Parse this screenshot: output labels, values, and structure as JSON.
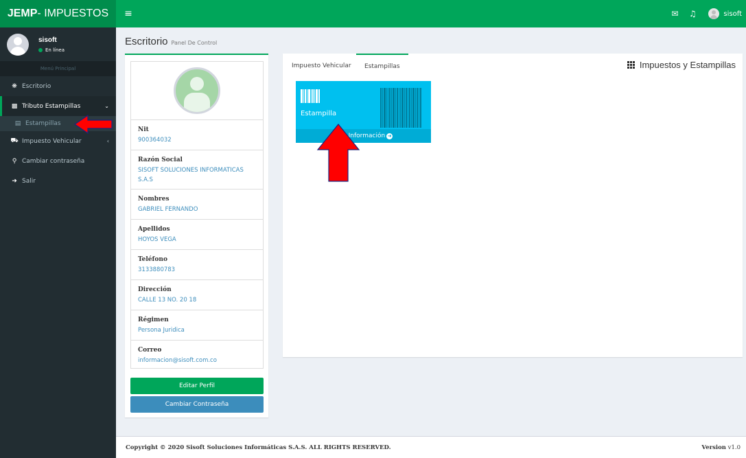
{
  "app": {
    "brand": "JEMP",
    "brand_rest": " - IMPUESTOS"
  },
  "topbar": {
    "user": "sisoft"
  },
  "sidebar": {
    "user_name": "sisoft",
    "status": "En línea",
    "menu_header": "Menú Principal",
    "items": [
      {
        "label": "Escritorio",
        "icon": "dashboard-icon"
      },
      {
        "label": "Tributo Estampillas",
        "icon": "barcode-icon"
      },
      {
        "label": "Estampillas",
        "icon": "file-icon"
      },
      {
        "label": "Impuesto Vehicular",
        "icon": "car-icon"
      },
      {
        "label": "Cambiar contraseña",
        "icon": "key-icon"
      },
      {
        "label": "Salir",
        "icon": "sign-out-icon"
      }
    ]
  },
  "header": {
    "title": "Escritorio",
    "subtitle": "Panel De Control"
  },
  "profile": {
    "fields": [
      {
        "label": "Nit",
        "value": "900364032"
      },
      {
        "label": "Razón Social",
        "value": "SISOFT SOLUCIONES INFORMATICAS S.A.S"
      },
      {
        "label": "Nombres",
        "value": "GABRIEL FERNANDO"
      },
      {
        "label": "Apellidos",
        "value": "HOYOS VEGA"
      },
      {
        "label": "Teléfono",
        "value": "3133880783"
      },
      {
        "label": "Dirección",
        "value": "CALLE 13 NO. 20 18"
      },
      {
        "label": "Régimen",
        "value": "Persona Juridica"
      },
      {
        "label": "Correo",
        "value": "informacion@sisoft.com.co"
      }
    ],
    "edit_button": "Editar Perfil",
    "password_button": "Cambiar Contraseña"
  },
  "tabs": {
    "items": [
      {
        "label": "Impuesto Vehicular"
      },
      {
        "label": "Estampillas"
      }
    ],
    "title": "Impuestos y Estampillas"
  },
  "stamp_card": {
    "label": "Estampilla",
    "footer": "Más Información",
    "color": "#00c0ef"
  },
  "footer": {
    "copyright": "Copyright © 2020 Sisoft Soluciones Informáticas S.A.S. ALL RIGHTS RESERVED.",
    "version_label": "Version",
    "version": "v1.0"
  },
  "colors": {
    "brand_green": "#00a65a",
    "sidebar_bg": "#222d32",
    "annotation_arrow": "#ff0000"
  }
}
